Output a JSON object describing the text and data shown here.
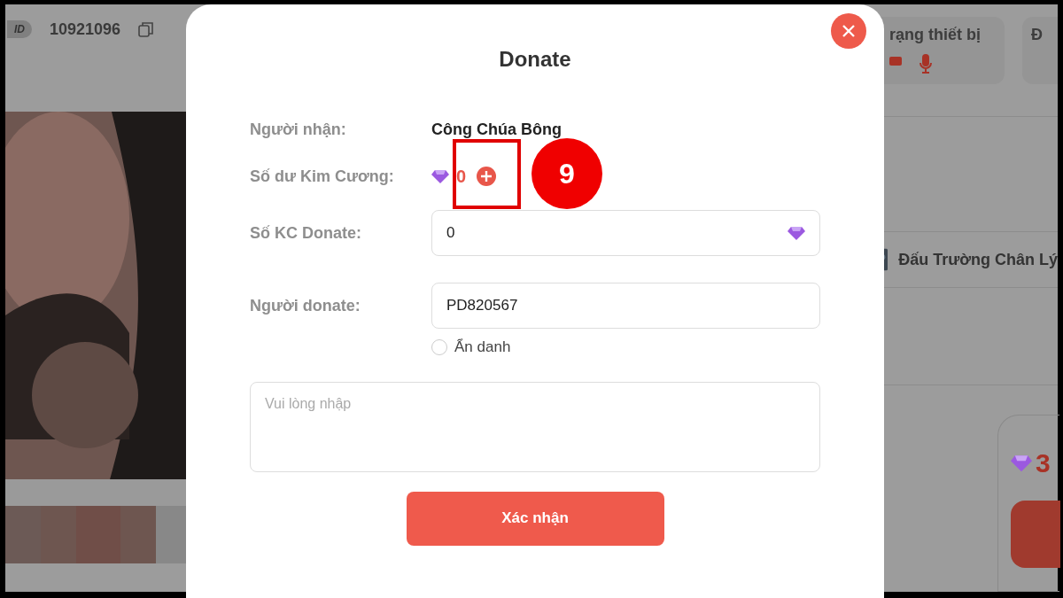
{
  "background": {
    "id_badge": "ID",
    "user_id": "10921096",
    "device_card": {
      "title": "rạng thiết bị"
    },
    "next_card": {
      "title": "Đ"
    },
    "game": {
      "name": "Đấu Trường Chân Lý"
    },
    "balance_card": {
      "amount": "3"
    }
  },
  "dialog": {
    "title": "Donate",
    "fields": [
      {
        "kind": "text",
        "label": "Người nhận:",
        "value": "Công Chúa Bông"
      },
      {
        "kind": "balance",
        "label": "Số dư Kim Cương:",
        "value": "0"
      },
      {
        "kind": "input",
        "label": "Số KC Donate:",
        "value": "0",
        "diamond": true
      },
      {
        "kind": "input",
        "label": "Người donate:",
        "value": "PD820567",
        "diamond": false
      }
    ],
    "anonymous": {
      "label": "Ẩn danh",
      "checked": false
    },
    "message": {
      "placeholder": "Vui lòng nhập"
    },
    "confirm": "Xác nhận"
  },
  "annotation": {
    "number": "9"
  }
}
